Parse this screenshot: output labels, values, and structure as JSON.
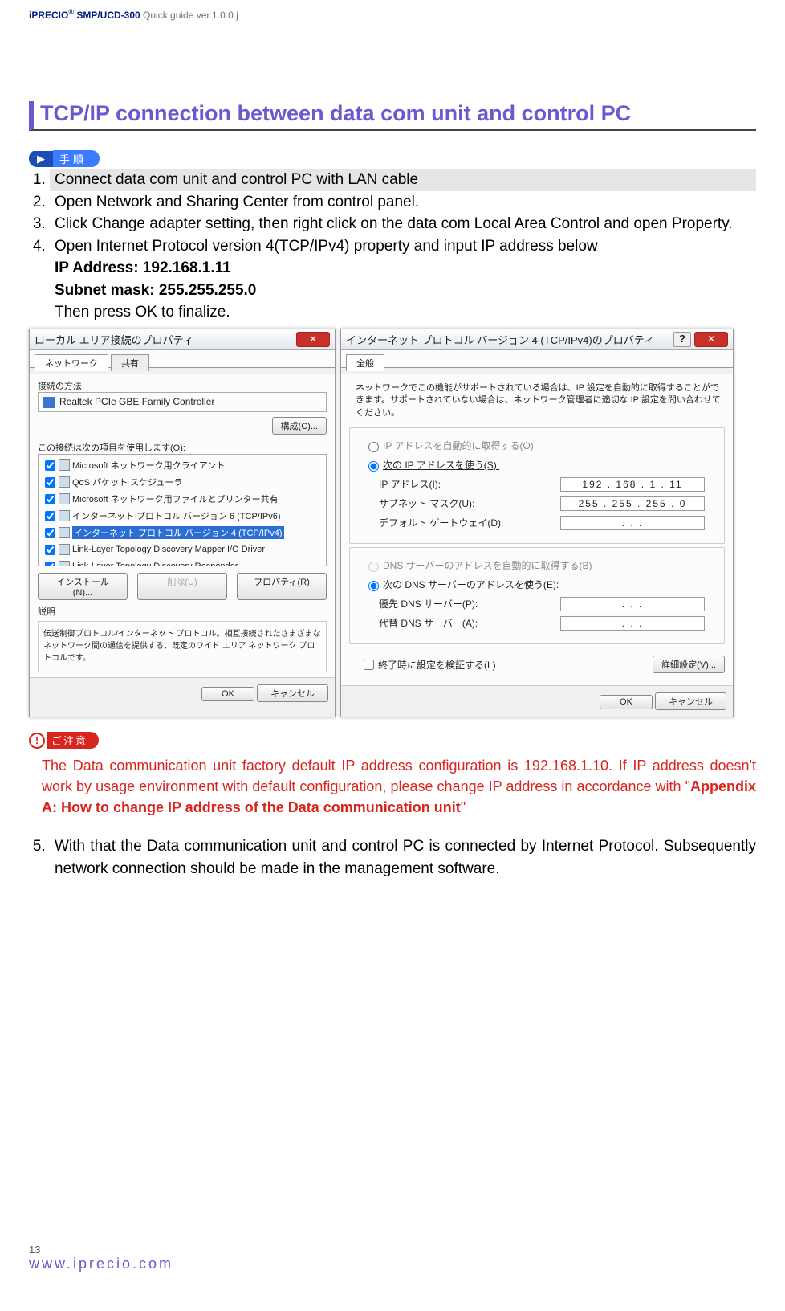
{
  "header": {
    "product": "iPRECIO",
    "sup": "®",
    "model": " SMP/UCD-300 ",
    "guide": "Quick guide ver.1.0.0.j"
  },
  "title": "TCP/IP connection between data com unit and control PC",
  "tejun_label": "手順",
  "steps": {
    "s1": "Connect data com unit and control PC with LAN cable",
    "s2": "Open Network and Sharing Center from control panel.",
    "s3": "Click Change adapter setting, then right click on the data com Local Area Control and open Property.",
    "s4_a": "Open Internet Protocol version 4(TCP/IPv4) property and input IP address below",
    "s4_ip": "IP Address: 192.168.1.11",
    "s4_mask": "Subnet mask: 255.255.255.0",
    "s4_b": "Then press OK to finalize."
  },
  "dlg1": {
    "title": "ローカル エリア接続のプロパティ",
    "tab_net": "ネットワーク",
    "tab_share": "共有",
    "conn_label": "接続の方法:",
    "adapter": "Realtek PCIe GBE Family Controller",
    "config_btn": "構成(C)...",
    "items_label": "この接続は次の項目を使用します(O):",
    "item1": "Microsoft ネットワーク用クライアント",
    "item2": "QoS パケット スケジューラ",
    "item3": "Microsoft ネットワーク用ファイルとプリンター共有",
    "item4": "インターネット プロトコル バージョン 6 (TCP/IPv6)",
    "item5": "インターネット プロトコル バージョン 4 (TCP/IPv4)",
    "item6": "Link-Layer Topology Discovery Mapper I/O Driver",
    "item7": "Link-Layer Topology Discovery Responder",
    "install": "インストール(N)...",
    "uninstall": "削除(U)",
    "props": "プロパティ(R)",
    "desc_h": "説明",
    "desc_t": "伝送制御プロトコル/インターネット プロトコル。相互接続されたさまざまなネットワーク間の通信を提供する、既定のワイド エリア ネットワーク プロトコルです。",
    "ok": "OK",
    "cancel": "キャンセル"
  },
  "dlg2": {
    "title": "インターネット プロトコル バージョン 4 (TCP/IPv4)のプロパティ",
    "tab": "全般",
    "intro": "ネットワークでこの機能がサポートされている場合は、IP 設定を自動的に取得することができます。サポートされていない場合は、ネットワーク管理者に適切な IP 設定を問い合わせてください。",
    "auto_ip": "IP アドレスを自動的に取得する(O)",
    "use_ip": "次の IP アドレスを使う(S):",
    "ip_lbl": "IP アドレス(I):",
    "ip_val": "192 . 168 .  1  .  11",
    "mask_lbl": "サブネット マスク(U):",
    "mask_val": "255 . 255 . 255 .   0",
    "gw_lbl": "デフォルト ゲートウェイ(D):",
    "gw_val": ".       .       .",
    "auto_dns": "DNS サーバーのアドレスを自動的に取得する(B)",
    "use_dns": "次の DNS サーバーのアドレスを使う(E):",
    "dns1_lbl": "優先 DNS サーバー(P):",
    "dns1_val": ".       .       .",
    "dns2_lbl": "代替 DNS サーバー(A):",
    "dns2_val": ".       .       .",
    "verify": "終了時に設定を検証する(L)",
    "adv": "詳細設定(V)...",
    "ok": "OK",
    "cancel": "キャンセル"
  },
  "gochu_label": "ご注意",
  "warning": {
    "t1": "The Data communication unit factory default IP address configuration is 192.168.1.10. If IP address doesn't work by usage environment with default configuration, please change IP address in accordance with \"",
    "ref": "Appendix A: How to change IP address of the Data communication unit",
    "t2": "\""
  },
  "step5": "With that the Data communication unit and control PC is connected by Internet Protocol. Subsequently network connection should be made in the management software.",
  "footer": {
    "page": "13",
    "url": "www.iprecio.com"
  }
}
